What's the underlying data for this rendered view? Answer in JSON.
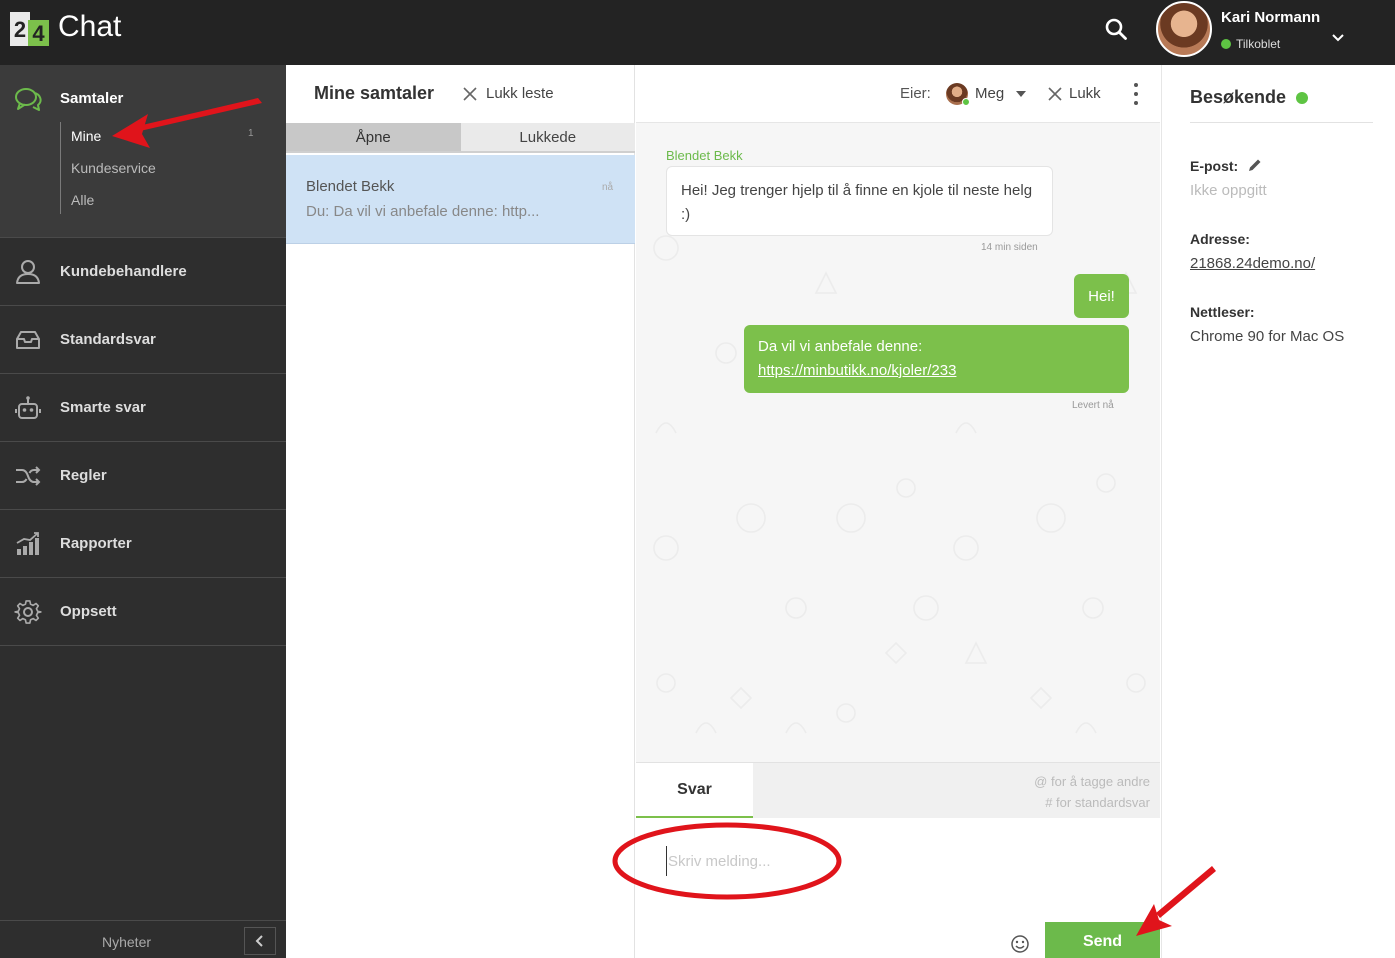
{
  "header": {
    "logo_digits": [
      "2",
      "4"
    ],
    "app_title": "Chat",
    "user_name": "Kari Normann",
    "user_status": "Tilkoblet",
    "status_color": "#5ec443"
  },
  "sidebar": {
    "primary_section": {
      "label": "Samtaler",
      "icon": "chat-bubbles-icon",
      "sub_items": [
        {
          "label": "Mine",
          "count": "1",
          "active": true
        },
        {
          "label": "Kundeservice"
        },
        {
          "label": "Alle"
        }
      ]
    },
    "items": [
      {
        "label": "Kundebehandlere",
        "icon": "user-icon"
      },
      {
        "label": "Standardsvar",
        "icon": "inbox-icon"
      },
      {
        "label": "Smarte svar",
        "icon": "robot-icon"
      },
      {
        "label": "Regler",
        "icon": "shuffle-icon"
      },
      {
        "label": "Rapporter",
        "icon": "chart-icon"
      },
      {
        "label": "Oppsett",
        "icon": "gear-icon"
      }
    ],
    "footer_label": "Nyheter"
  },
  "conversations": {
    "title": "Mine samtaler",
    "close_read_label": "Lukk leste",
    "tabs": [
      {
        "label": "Åpne",
        "active": true
      },
      {
        "label": "Lukkede",
        "active": false
      }
    ],
    "items": [
      {
        "name": "Blendet Bekk",
        "time": "nå",
        "preview": "Du: Da vil vi anbefale denne: http..."
      }
    ]
  },
  "chat": {
    "owner_label": "Eier:",
    "owner_name": "Meg",
    "close_label": "Lukk",
    "messages": {
      "incoming": {
        "sender": "Blendet Bekk",
        "text": "Hei! Jeg trenger hjelp til å finne en kjole til neste helg :)",
        "time": "14 min siden"
      },
      "outgoing_1": {
        "text": "Hei!"
      },
      "outgoing_2": {
        "text": "Da vil vi anbefale denne:",
        "link": "https://minbutikk.no/kjoler/233"
      },
      "delivered": "Levert nå"
    },
    "reply_tab": "Svar",
    "hint_tag": "@ for å tagge andre",
    "hint_standard": "# for standardsvar",
    "input_placeholder": "Skriv melding...",
    "send_label": "Send",
    "accent_color": "#7cc04b"
  },
  "visitor": {
    "title": "Besøkende",
    "email_label": "E-post:",
    "email_value": "Ikke oppgitt",
    "address_label": "Adresse:",
    "address_value": "21868.24demo.no/",
    "browser_label": "Nettleser:",
    "browser_value": "Chrome 90 for Mac OS"
  },
  "annotations": {
    "color": "#e0141b"
  }
}
